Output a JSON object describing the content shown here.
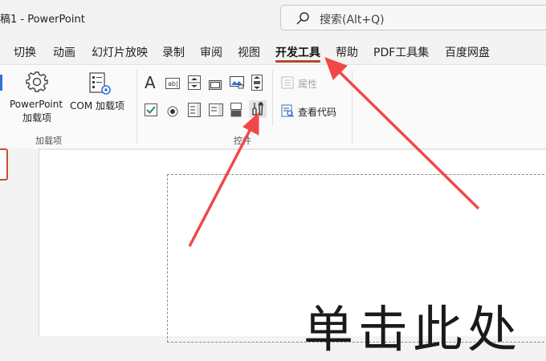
{
  "titlebar": {
    "title": "稿1  -  PowerPoint"
  },
  "search": {
    "placeholder": "搜索(Alt+Q)"
  },
  "tabs": [
    "切换",
    "动画",
    "幻灯片放映",
    "录制",
    "审阅",
    "视图",
    "开发工具",
    "帮助",
    "PDF工具集",
    "百度网盘"
  ],
  "active_tab": "开发工具",
  "ribbon": {
    "addins": {
      "powerpoint_addins_line1": "PowerPoint",
      "powerpoint_addins_line2": "加载项",
      "com_addins": "COM 加载项",
      "group_label": "加载项"
    },
    "controls": {
      "properties_label": "属性",
      "view_code_label": "查看代码",
      "group_label": "控件"
    }
  },
  "slide": {
    "placeholder_text": "单击此处"
  },
  "colors": {
    "accent": "#b7472a",
    "arrow": "#f0484a"
  }
}
